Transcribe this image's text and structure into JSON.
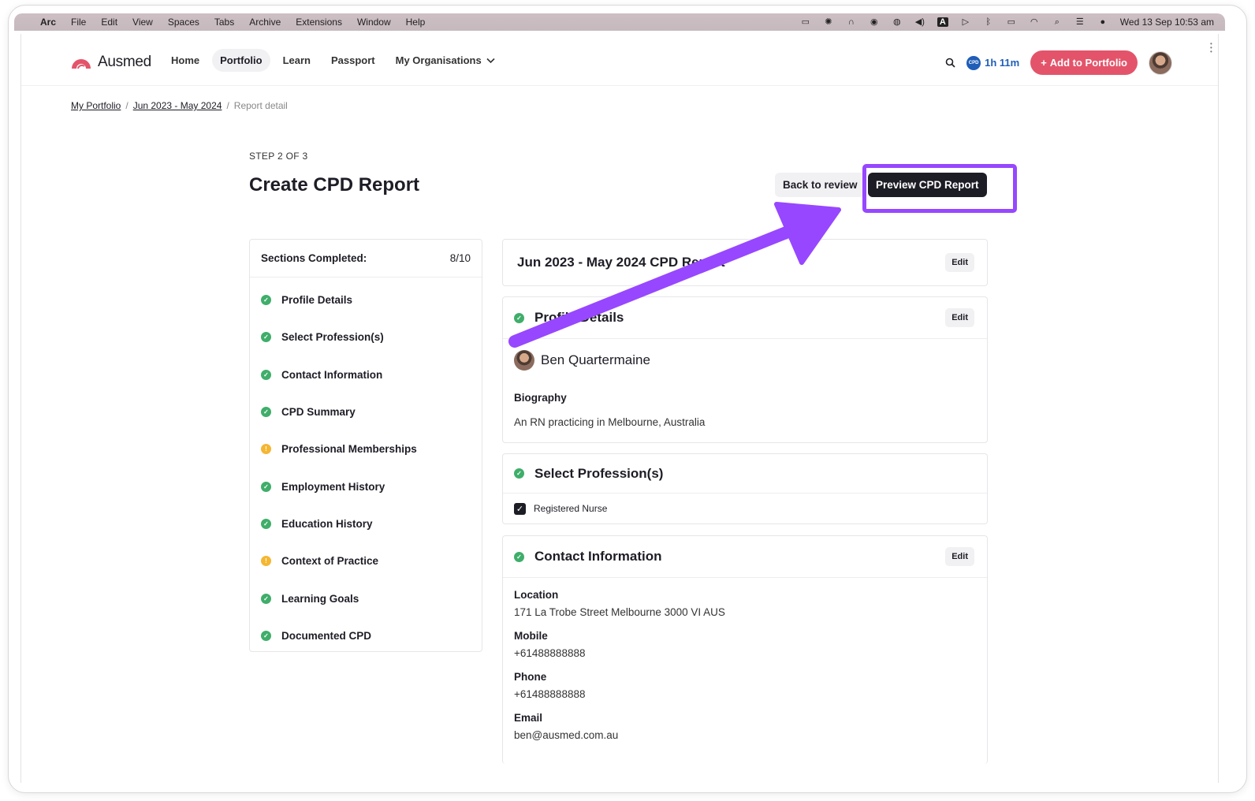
{
  "menubar": {
    "apple": "",
    "app": "Arc",
    "items": [
      "File",
      "Edit",
      "View",
      "Spaces",
      "Tabs",
      "Archive",
      "Extensions",
      "Window",
      "Help"
    ],
    "clock": "Wed 13 Sep  10:53 am"
  },
  "nav": {
    "brand": "Ausmed",
    "links": [
      "Home",
      "Portfolio",
      "Learn",
      "Passport",
      "My Organisations"
    ],
    "active_link": "Portfolio",
    "cpd_badge": "CPD",
    "cpd_time": "1h 11m",
    "add_button": "Add to Portfolio",
    "add_button_plus": "+"
  },
  "breadcrumb": {
    "items": [
      "My Portfolio",
      "Jun 2023 - May 2024",
      "Report detail"
    ],
    "separator": "/"
  },
  "page": {
    "step": "STEP 2 OF 3",
    "title": "Create CPD Report",
    "back_button": "Back to review",
    "preview_button": "Preview CPD Report"
  },
  "sidebar": {
    "header_label": "Sections Completed:",
    "header_count": "8/10",
    "items": [
      {
        "label": "Profile Details",
        "status": "complete"
      },
      {
        "label": "Select Profession(s)",
        "status": "complete"
      },
      {
        "label": "Contact Information",
        "status": "complete"
      },
      {
        "label": "CPD Summary",
        "status": "complete"
      },
      {
        "label": "Professional Memberships",
        "status": "warning"
      },
      {
        "label": "Employment History",
        "status": "complete"
      },
      {
        "label": "Education History",
        "status": "complete"
      },
      {
        "label": "Context of Practice",
        "status": "warning"
      },
      {
        "label": "Learning Goals",
        "status": "complete"
      },
      {
        "label": "Documented CPD",
        "status": "complete"
      }
    ],
    "warn_glyph": "!",
    "ok_glyph": "✓"
  },
  "report": {
    "title": "Jun 2023 - May 2024 CPD Report",
    "edit": "Edit"
  },
  "profile": {
    "title": "Profile Details",
    "edit": "Edit",
    "name": "Ben Quartermaine",
    "bio_label": "Biography",
    "bio": "An RN practicing in Melbourne, Australia"
  },
  "professions": {
    "title": "Select Profession(s)",
    "items": [
      "Registered Nurse"
    ]
  },
  "contact": {
    "title": "Contact Information",
    "edit": "Edit",
    "location_label": "Location",
    "location": "171 La Trobe Street Melbourne 3000 VI AUS",
    "mobile_label": "Mobile",
    "mobile": "+61488888888",
    "phone_label": "Phone",
    "phone": "+61488888888",
    "email_label": "Email",
    "email": "ben@ausmed.com.au"
  },
  "annotation": {
    "arrow_color": "#9747ff",
    "highlight_color": "#9747ff"
  },
  "colors": {
    "brand_red": "#e3546a",
    "cpd_blue": "#1f5db8",
    "complete_green": "#3fae6a",
    "warning_yellow": "#f5b631",
    "dark": "#1d1d26"
  }
}
